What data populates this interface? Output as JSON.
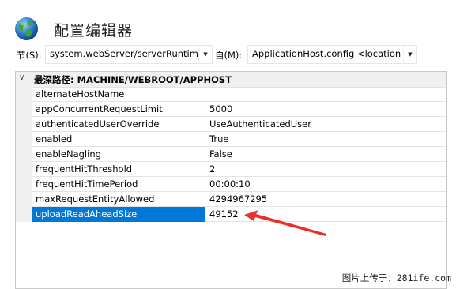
{
  "header": {
    "title": "配置编辑器"
  },
  "toolbar": {
    "section_label": "节(S):",
    "section_value": "system.webServer/serverRuntime",
    "from_label": "自(M):",
    "from_value": "ApplicationHost.config <location"
  },
  "grid": {
    "section_header": "最深路径: MACHINE/WEBROOT/APPHOST",
    "rows": [
      {
        "name": "alternateHostName",
        "value": ""
      },
      {
        "name": "appConcurrentRequestLimit",
        "value": "5000"
      },
      {
        "name": "authenticatedUserOverride",
        "value": "UseAuthenticatedUser"
      },
      {
        "name": "enabled",
        "value": "True"
      },
      {
        "name": "enableNagling",
        "value": "False"
      },
      {
        "name": "frequentHitThreshold",
        "value": "2"
      },
      {
        "name": "frequentHitTimePeriod",
        "value": "00:00:10"
      },
      {
        "name": "maxRequestEntityAllowed",
        "value": "4294967295"
      },
      {
        "name": "uploadReadAheadSize",
        "value": "49152"
      }
    ]
  },
  "annotation": {
    "color": "#e8302a"
  },
  "watermark": {
    "text": "图片上传于：281ife.com"
  },
  "icons": {
    "app": "globe-icon",
    "dropdown": "chevron-down-icon",
    "collapse": "chevron-collapse-icon"
  }
}
